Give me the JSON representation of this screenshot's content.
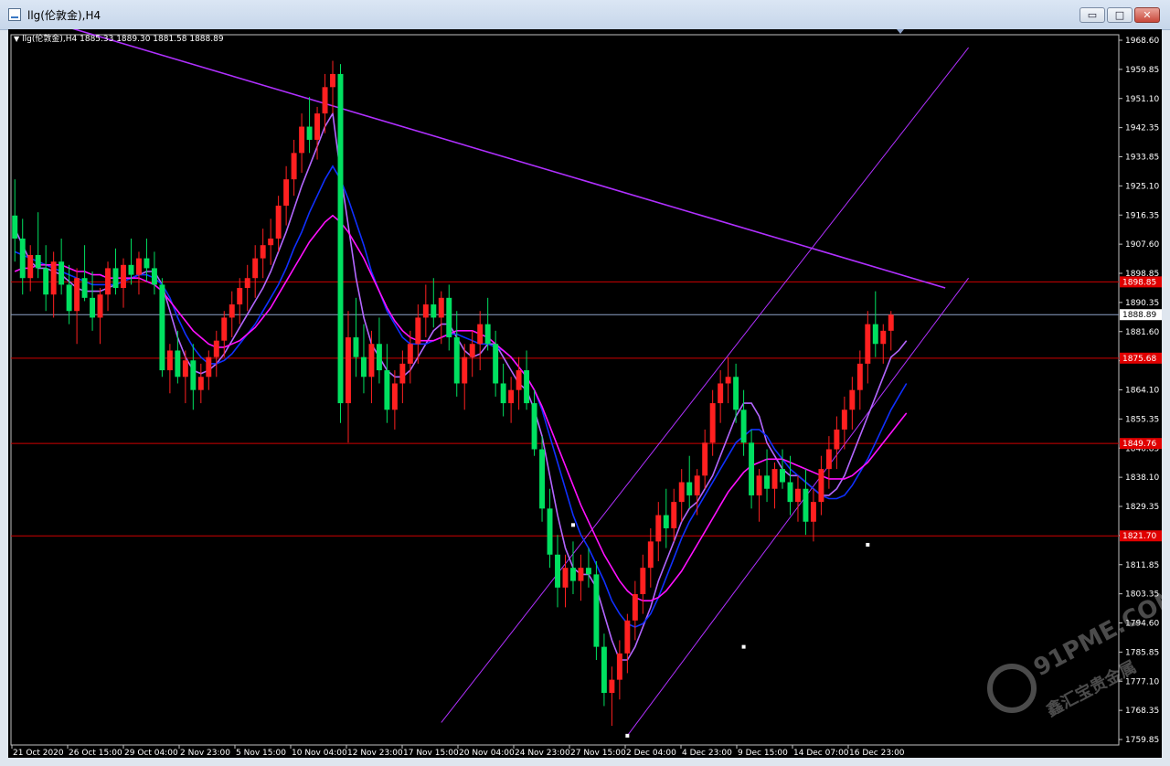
{
  "window": {
    "title": "llg(伦敦金),H4",
    "buttons": {
      "minimize": "▭",
      "restore": "□",
      "close": "✕"
    }
  },
  "header": {
    "symbol": "llg(伦敦金),H4",
    "ohlc": "1885.33 1889.30 1881.58 1888.89"
  },
  "watermark": {
    "text": "91PME.COM",
    "subtext": "鑫汇宝贵金属"
  },
  "colors": {
    "bull": "#ff2020",
    "bear": "#00e060",
    "ma_fast": "#b366ff",
    "ma_mid": "#1030ff",
    "ma_slow": "#ff10ff",
    "trendline": "#b030ff",
    "hline": "#d00000",
    "current": "#8da2c8"
  },
  "chart_data": {
    "type": "candlestick",
    "timeframe": "H4",
    "ylim": [
      1759.85,
      1972.25
    ],
    "ticks": [
      "1968.60",
      "1959.85",
      "1951.10",
      "1942.35",
      "1933.85",
      "1925.10",
      "1916.35",
      "1907.60",
      "1898.85",
      "1890.35",
      "1881.60",
      "1872.85",
      "1864.10",
      "1855.35",
      "1846.85",
      "1838.10",
      "1829.35",
      "1820.60",
      "1811.85",
      "1803.35",
      "1794.60",
      "1785.85",
      "1777.10",
      "1768.35",
      "1759.85"
    ],
    "xlabels": [
      "21 Oct 2020",
      "26 Oct 15:00",
      "29 Oct 04:00",
      "2 Nov 23:00",
      "5 Nov 15:00",
      "10 Nov 04:00",
      "12 Nov 23:00",
      "17 Nov 15:00",
      "20 Nov 04:00",
      "24 Nov 23:00",
      "27 Nov 15:00",
      "2 Dec 04:00",
      "4 Dec 23:00",
      "9 Dec 15:00",
      "14 Dec 07:00",
      "16 Dec 23:00"
    ],
    "hlines": [
      {
        "value": 1898.85,
        "label": "1898.85"
      },
      {
        "value": 1875.68,
        "label": "1875.68"
      },
      {
        "value": 1849.76,
        "label": "1849.76"
      },
      {
        "value": 1821.7,
        "label": "1821.70"
      }
    ],
    "current_price": {
      "value": 1888.89,
      "label": "1888.89"
    },
    "candles": [
      [
        1919,
        1930,
        1905,
        1912
      ],
      [
        1912,
        1918,
        1895,
        1900
      ],
      [
        1900,
        1910,
        1896,
        1907
      ],
      [
        1907,
        1920,
        1900,
        1903
      ],
      [
        1903,
        1910,
        1890,
        1895
      ],
      [
        1895,
        1908,
        1888,
        1905
      ],
      [
        1905,
        1912,
        1895,
        1898
      ],
      [
        1898,
        1904,
        1886,
        1890
      ],
      [
        1890,
        1903,
        1880,
        1900
      ],
      [
        1900,
        1910,
        1893,
        1894
      ],
      [
        1894,
        1902,
        1884,
        1888
      ],
      [
        1888,
        1897,
        1880,
        1895
      ],
      [
        1895,
        1905,
        1890,
        1903
      ],
      [
        1903,
        1909,
        1895,
        1897
      ],
      [
        1897,
        1906,
        1891,
        1904
      ],
      [
        1904,
        1912,
        1898,
        1901
      ],
      [
        1901,
        1908,
        1895,
        1906
      ],
      [
        1906,
        1912,
        1899,
        1903
      ],
      [
        1903,
        1908,
        1895,
        1898
      ],
      [
        1898,
        1900,
        1870,
        1872
      ],
      [
        1872,
        1880,
        1865,
        1878
      ],
      [
        1878,
        1884,
        1868,
        1870
      ],
      [
        1870,
        1878,
        1862,
        1875
      ],
      [
        1875,
        1880,
        1860,
        1866
      ],
      [
        1866,
        1874,
        1862,
        1870
      ],
      [
        1870,
        1878,
        1866,
        1876
      ],
      [
        1876,
        1884,
        1870,
        1881
      ],
      [
        1881,
        1890,
        1876,
        1888
      ],
      [
        1888,
        1896,
        1882,
        1892
      ],
      [
        1892,
        1900,
        1886,
        1897
      ],
      [
        1897,
        1904,
        1890,
        1900
      ],
      [
        1900,
        1910,
        1894,
        1906
      ],
      [
        1906,
        1915,
        1900,
        1910
      ],
      [
        1910,
        1918,
        1904,
        1912
      ],
      [
        1912,
        1925,
        1908,
        1922
      ],
      [
        1922,
        1934,
        1916,
        1930
      ],
      [
        1930,
        1942,
        1925,
        1938
      ],
      [
        1938,
        1950,
        1932,
        1946
      ],
      [
        1946,
        1955,
        1938,
        1942
      ],
      [
        1942,
        1952,
        1936,
        1950
      ],
      [
        1950,
        1962,
        1944,
        1958
      ],
      [
        1958,
        1966,
        1950,
        1962
      ],
      [
        1962,
        1965,
        1856,
        1862
      ],
      [
        1862,
        1890,
        1850,
        1882
      ],
      [
        1882,
        1894,
        1870,
        1876
      ],
      [
        1876,
        1886,
        1865,
        1870
      ],
      [
        1870,
        1884,
        1862,
        1880
      ],
      [
        1880,
        1888,
        1868,
        1872
      ],
      [
        1872,
        1880,
        1856,
        1860
      ],
      [
        1860,
        1872,
        1854,
        1868
      ],
      [
        1868,
        1878,
        1862,
        1874
      ],
      [
        1874,
        1884,
        1868,
        1880
      ],
      [
        1880,
        1892,
        1874,
        1888
      ],
      [
        1888,
        1898,
        1882,
        1892
      ],
      [
        1892,
        1900,
        1885,
        1888
      ],
      [
        1888,
        1896,
        1880,
        1894
      ],
      [
        1894,
        1898,
        1878,
        1882
      ],
      [
        1882,
        1890,
        1864,
        1868
      ],
      [
        1868,
        1880,
        1860,
        1876
      ],
      [
        1876,
        1884,
        1870,
        1880
      ],
      [
        1880,
        1890,
        1872,
        1886
      ],
      [
        1886,
        1894,
        1878,
        1880
      ],
      [
        1880,
        1884,
        1864,
        1868
      ],
      [
        1868,
        1874,
        1858,
        1862
      ],
      [
        1862,
        1870,
        1856,
        1866
      ],
      [
        1866,
        1876,
        1860,
        1872
      ],
      [
        1872,
        1878,
        1860,
        1862
      ],
      [
        1862,
        1866,
        1846,
        1848
      ],
      [
        1848,
        1852,
        1826,
        1830
      ],
      [
        1830,
        1836,
        1812,
        1816
      ],
      [
        1816,
        1822,
        1800,
        1806
      ],
      [
        1806,
        1816,
        1800,
        1812
      ],
      [
        1812,
        1820,
        1804,
        1808
      ],
      [
        1808,
        1816,
        1802,
        1812
      ],
      [
        1812,
        1818,
        1806,
        1810
      ],
      [
        1810,
        1814,
        1784,
        1788
      ],
      [
        1788,
        1792,
        1770,
        1774
      ],
      [
        1774,
        1782,
        1764,
        1778
      ],
      [
        1778,
        1790,
        1772,
        1786
      ],
      [
        1786,
        1798,
        1780,
        1796
      ],
      [
        1796,
        1808,
        1790,
        1804
      ],
      [
        1804,
        1816,
        1798,
        1812
      ],
      [
        1812,
        1824,
        1806,
        1820
      ],
      [
        1820,
        1832,
        1814,
        1828
      ],
      [
        1828,
        1836,
        1818,
        1824
      ],
      [
        1824,
        1836,
        1820,
        1832
      ],
      [
        1832,
        1842,
        1826,
        1838
      ],
      [
        1838,
        1846,
        1830,
        1834
      ],
      [
        1834,
        1842,
        1828,
        1840
      ],
      [
        1840,
        1854,
        1836,
        1850
      ],
      [
        1850,
        1866,
        1846,
        1862
      ],
      [
        1862,
        1872,
        1856,
        1868
      ],
      [
        1868,
        1876,
        1862,
        1870
      ],
      [
        1870,
        1874,
        1856,
        1860
      ],
      [
        1860,
        1866,
        1846,
        1850
      ],
      [
        1850,
        1854,
        1830,
        1834
      ],
      [
        1834,
        1842,
        1826,
        1840
      ],
      [
        1840,
        1848,
        1832,
        1836
      ],
      [
        1836,
        1844,
        1830,
        1842
      ],
      [
        1842,
        1848,
        1836,
        1838
      ],
      [
        1838,
        1846,
        1828,
        1832
      ],
      [
        1832,
        1840,
        1826,
        1836
      ],
      [
        1836,
        1842,
        1822,
        1826
      ],
      [
        1826,
        1836,
        1820,
        1832
      ],
      [
        1832,
        1846,
        1828,
        1842
      ],
      [
        1842,
        1852,
        1836,
        1848
      ],
      [
        1848,
        1858,
        1842,
        1854
      ],
      [
        1854,
        1864,
        1848,
        1860
      ],
      [
        1860,
        1870,
        1854,
        1866
      ],
      [
        1866,
        1878,
        1860,
        1874
      ],
      [
        1874,
        1890,
        1868,
        1886
      ],
      [
        1886,
        1896,
        1876,
        1880
      ],
      [
        1880,
        1886,
        1874,
        1884
      ],
      [
        1884,
        1890,
        1878,
        1888.89
      ]
    ],
    "series": [
      {
        "name": "MA fast",
        "color": "#b366ff",
        "values": [
          1915,
          1910,
          1905,
          1903,
          1903,
          1902,
          1901,
          1899,
          1897,
          1896,
          1896,
          1896,
          1897,
          1898,
          1899,
          1900,
          1901,
          1902,
          1902,
          1898,
          1890,
          1882,
          1876,
          1872,
          1871,
          1872,
          1874,
          1877,
          1881,
          1885,
          1889,
          1893,
          1897,
          1902,
          1908,
          1914,
          1921,
          1928,
          1934,
          1940,
          1946,
          1950,
          1932,
          1916,
          1900,
          1888,
          1880,
          1876,
          1872,
          1870,
          1870,
          1872,
          1876,
          1880,
          1884,
          1886,
          1886,
          1882,
          1878,
          1876,
          1877,
          1880,
          1880,
          1876,
          1872,
          1868,
          1866,
          1860,
          1852,
          1840,
          1828,
          1818,
          1812,
          1810,
          1810,
          1806,
          1798,
          1790,
          1784,
          1784,
          1788,
          1794,
          1800,
          1808,
          1814,
          1820,
          1826,
          1830,
          1832,
          1836,
          1840,
          1846,
          1852,
          1858,
          1862,
          1862,
          1858,
          1850,
          1846,
          1842,
          1840,
          1840,
          1838,
          1836,
          1834,
          1834,
          1836,
          1840,
          1846,
          1852,
          1858,
          1864,
          1870,
          1876,
          1878,
          1881
        ]
      },
      {
        "name": "MA mid",
        "color": "#1030ff",
        "values": [
          1908,
          1907,
          1906,
          1905,
          1904,
          1903,
          1902,
          1901,
          1900,
          1899,
          1898,
          1898,
          1898,
          1898,
          1899,
          1900,
          1901,
          1901,
          1900,
          1898,
          1894,
          1888,
          1883,
          1879,
          1876,
          1874,
          1874,
          1875,
          1877,
          1880,
          1883,
          1886,
          1890,
          1894,
          1898,
          1903,
          1909,
          1914,
          1920,
          1925,
          1930,
          1934,
          1930,
          1924,
          1917,
          1910,
          1902,
          1896,
          1890,
          1886,
          1882,
          1880,
          1880,
          1880,
          1881,
          1882,
          1883,
          1883,
          1882,
          1881,
          1880,
          1880,
          1879,
          1878,
          1876,
          1873,
          1870,
          1866,
          1860,
          1852,
          1844,
          1836,
          1828,
          1822,
          1818,
          1813,
          1808,
          1802,
          1798,
          1795,
          1794,
          1795,
          1798,
          1803,
          1809,
          1815,
          1821,
          1826,
          1830,
          1834,
          1838,
          1842,
          1846,
          1850,
          1852,
          1854,
          1854,
          1852,
          1848,
          1845,
          1842,
          1840,
          1838,
          1836,
          1834,
          1833,
          1833,
          1834,
          1837,
          1841,
          1845,
          1850,
          1855,
          1860,
          1864,
          1868
        ]
      },
      {
        "name": "MA slow",
        "color": "#ff10ff",
        "values": [
          1902,
          1903,
          1903,
          1904,
          1904,
          1904,
          1904,
          1903,
          1902,
          1902,
          1901,
          1901,
          1900,
          1900,
          1900,
          1900,
          1900,
          1899,
          1898,
          1896,
          1893,
          1890,
          1887,
          1884,
          1882,
          1880,
          1879,
          1879,
          1880,
          1881,
          1883,
          1885,
          1888,
          1891,
          1895,
          1899,
          1903,
          1907,
          1911,
          1914,
          1917,
          1919,
          1917,
          1914,
          1910,
          1906,
          1901,
          1896,
          1891,
          1887,
          1884,
          1882,
          1881,
          1881,
          1881,
          1882,
          1883,
          1884,
          1884,
          1884,
          1883,
          1882,
          1880,
          1878,
          1876,
          1873,
          1870,
          1866,
          1861,
          1855,
          1849,
          1843,
          1837,
          1831,
          1826,
          1821,
          1816,
          1812,
          1808,
          1805,
          1803,
          1802,
          1802,
          1803,
          1805,
          1808,
          1811,
          1815,
          1819,
          1823,
          1827,
          1831,
          1835,
          1838,
          1841,
          1843,
          1844,
          1845,
          1845,
          1845,
          1844,
          1843,
          1842,
          1841,
          1840,
          1839,
          1839,
          1839,
          1840,
          1842,
          1844,
          1847,
          1850,
          1853,
          1856,
          1859
        ]
      }
    ],
    "trendlines": [
      {
        "name": "resistance",
        "from": [
          0,
          1981
        ],
        "to": [
          120,
          1897
        ]
      },
      {
        "name": "channel-upper",
        "from": [
          55,
          1765
        ],
        "to": [
          123,
          1970
        ]
      },
      {
        "name": "channel-lower",
        "from": [
          79,
          1761
        ],
        "to": [
          123,
          1900
        ]
      }
    ],
    "anchor_points": [
      {
        "bar": 72,
        "value": 1825
      },
      {
        "bar": 79,
        "value": 1761
      },
      {
        "bar": 94,
        "value": 1788
      },
      {
        "bar": 110,
        "value": 1819
      }
    ]
  }
}
